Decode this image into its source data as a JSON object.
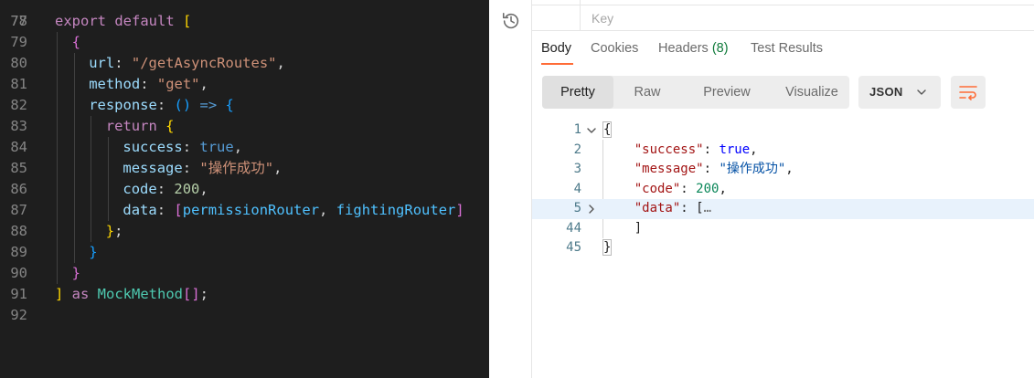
{
  "editor": {
    "top_line_number": "77",
    "lines": [
      {
        "num": "78",
        "indent": 0,
        "tokens": [
          {
            "t": "export ",
            "c": "t-kw"
          },
          {
            "t": "default ",
            "c": "t-kw"
          },
          {
            "t": "[",
            "c": "b1"
          }
        ]
      },
      {
        "num": "79",
        "indent": 1,
        "tokens": [
          {
            "t": "{",
            "c": "b2"
          }
        ]
      },
      {
        "num": "80",
        "indent": 2,
        "tokens": [
          {
            "t": "url",
            "c": "t-prop"
          },
          {
            "t": ": ",
            "c": "t-p"
          },
          {
            "t": "\"/getAsyncRoutes\"",
            "c": "t-str"
          },
          {
            "t": ",",
            "c": "t-p"
          }
        ]
      },
      {
        "num": "81",
        "indent": 2,
        "tokens": [
          {
            "t": "method",
            "c": "t-prop"
          },
          {
            "t": ": ",
            "c": "t-p"
          },
          {
            "t": "\"get\"",
            "c": "t-str"
          },
          {
            "t": ",",
            "c": "t-p"
          }
        ]
      },
      {
        "num": "82",
        "indent": 2,
        "tokens": [
          {
            "t": "response",
            "c": "t-prop"
          },
          {
            "t": ": ",
            "c": "t-p"
          },
          {
            "t": "()",
            "c": "b3"
          },
          {
            "t": " => ",
            "c": "t-kw2"
          },
          {
            "t": "{",
            "c": "b3"
          }
        ]
      },
      {
        "num": "83",
        "indent": 3,
        "tokens": [
          {
            "t": "return ",
            "c": "t-kw"
          },
          {
            "t": "{",
            "c": "b1"
          }
        ]
      },
      {
        "num": "84",
        "indent": 4,
        "tokens": [
          {
            "t": "success",
            "c": "t-prop"
          },
          {
            "t": ": ",
            "c": "t-p"
          },
          {
            "t": "true",
            "c": "t-kw2"
          },
          {
            "t": ",",
            "c": "t-p"
          }
        ]
      },
      {
        "num": "85",
        "indent": 4,
        "tokens": [
          {
            "t": "message",
            "c": "t-prop"
          },
          {
            "t": ": ",
            "c": "t-p"
          },
          {
            "t": "\"操作成功\"",
            "c": "t-str"
          },
          {
            "t": ",",
            "c": "t-p"
          }
        ]
      },
      {
        "num": "86",
        "indent": 4,
        "tokens": [
          {
            "t": "code",
            "c": "t-prop"
          },
          {
            "t": ": ",
            "c": "t-p"
          },
          {
            "t": "200",
            "c": "t-num"
          },
          {
            "t": ",",
            "c": "t-p"
          }
        ]
      },
      {
        "num": "87",
        "indent": 4,
        "tokens": [
          {
            "t": "data",
            "c": "t-prop"
          },
          {
            "t": ": ",
            "c": "t-p"
          },
          {
            "t": "[",
            "c": "b2"
          },
          {
            "t": "permissionRouter",
            "c": "t-ref"
          },
          {
            "t": ", ",
            "c": "t-p"
          },
          {
            "t": "fightingRouter",
            "c": "t-ref"
          },
          {
            "t": "]",
            "c": "b2"
          }
        ]
      },
      {
        "num": "88",
        "indent": 3,
        "tokens": [
          {
            "t": "}",
            "c": "b1"
          },
          {
            "t": ";",
            "c": "t-p"
          }
        ]
      },
      {
        "num": "89",
        "indent": 2,
        "tokens": [
          {
            "t": "}",
            "c": "b3"
          }
        ]
      },
      {
        "num": "90",
        "indent": 1,
        "tokens": [
          {
            "t": "}",
            "c": "b2"
          }
        ]
      },
      {
        "num": "91",
        "indent": 0,
        "tokens": [
          {
            "t": "]",
            "c": "b1"
          },
          {
            "t": " as ",
            "c": "t-kw"
          },
          {
            "t": "MockMethod",
            "c": "t-type"
          },
          {
            "t": "[]",
            "c": "b2"
          },
          {
            "t": ";",
            "c": "t-p"
          }
        ]
      },
      {
        "num": "92",
        "indent": 0,
        "tokens": []
      }
    ]
  },
  "params": {
    "key_label": "Key"
  },
  "response_tabs": {
    "body": "Body",
    "cookies": "Cookies",
    "headers": "Headers",
    "headers_count": "(8)",
    "test_results": "Test Results"
  },
  "view_modes": {
    "pretty": "Pretty",
    "raw": "Raw",
    "preview": "Preview",
    "visualize": "Visualize"
  },
  "format": {
    "selected": "JSON"
  },
  "json_body": {
    "lines": [
      {
        "num": "1",
        "arrow": "down",
        "tokens": [
          {
            "t": "{",
            "c": "j-p brace-box"
          }
        ]
      },
      {
        "num": "2",
        "tokens": [
          {
            "t": "    ",
            "c": "j-p"
          },
          {
            "t": "\"success\"",
            "c": "j-key"
          },
          {
            "t": ": ",
            "c": "j-p"
          },
          {
            "t": "true",
            "c": "j-bool"
          },
          {
            "t": ",",
            "c": "j-p"
          }
        ]
      },
      {
        "num": "3",
        "tokens": [
          {
            "t": "    ",
            "c": "j-p"
          },
          {
            "t": "\"message\"",
            "c": "j-key"
          },
          {
            "t": ": ",
            "c": "j-p"
          },
          {
            "t": "\"操作成功\"",
            "c": "j-str"
          },
          {
            "t": ",",
            "c": "j-p"
          }
        ]
      },
      {
        "num": "4",
        "tokens": [
          {
            "t": "    ",
            "c": "j-p"
          },
          {
            "t": "\"code\"",
            "c": "j-key"
          },
          {
            "t": ": ",
            "c": "j-p"
          },
          {
            "t": "200",
            "c": "j-num"
          },
          {
            "t": ",",
            "c": "j-p"
          }
        ]
      },
      {
        "num": "5",
        "arrow": "right",
        "highlight": true,
        "tokens": [
          {
            "t": "    ",
            "c": "j-p"
          },
          {
            "t": "\"data\"",
            "c": "j-key"
          },
          {
            "t": ": ",
            "c": "j-p"
          },
          {
            "t": "[",
            "c": "j-p"
          },
          {
            "t": "…",
            "c": "j-ell"
          }
        ]
      },
      {
        "num": "44",
        "tokens": [
          {
            "t": "    ",
            "c": "j-p"
          },
          {
            "t": "]",
            "c": "j-p"
          }
        ]
      },
      {
        "num": "45",
        "tokens": [
          {
            "t": "}",
            "c": "j-p brace-box"
          }
        ]
      }
    ]
  }
}
